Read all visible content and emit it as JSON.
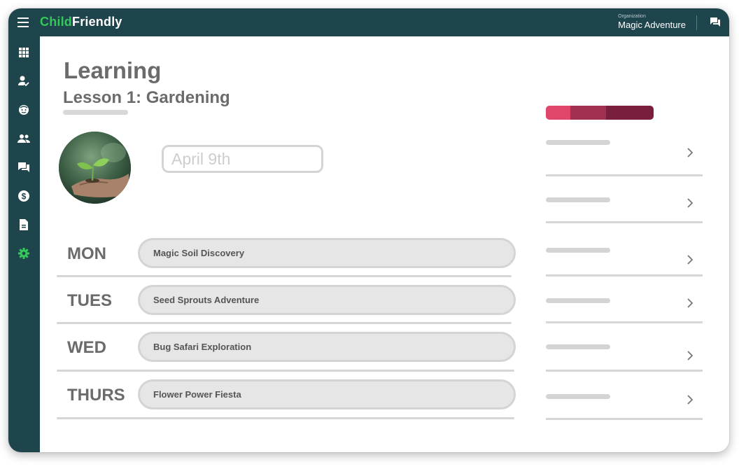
{
  "app": {
    "brand_part1": "Child",
    "brand_part2": "Friendly",
    "organization_label": "Organization",
    "organization_name": "Magic Adventure"
  },
  "sidebar": {
    "items": [
      {
        "icon": "grid-icon",
        "active": false
      },
      {
        "icon": "person-check-icon",
        "active": false
      },
      {
        "icon": "child-face-icon",
        "active": false
      },
      {
        "icon": "people-icon",
        "active": false
      },
      {
        "icon": "chat-icon",
        "active": false
      },
      {
        "icon": "dollar-icon",
        "active": false
      },
      {
        "icon": "document-icon",
        "active": false
      },
      {
        "icon": "gear-icon",
        "active": true
      }
    ]
  },
  "main": {
    "title": "Learning",
    "subtitle": "Lesson 1: Gardening",
    "date_value": "April 9th",
    "schedule": [
      {
        "day": "MON",
        "activity": "Magic Soil Discovery"
      },
      {
        "day": "TUES",
        "activity": "Seed Sprouts Adventure"
      },
      {
        "day": "WED",
        "activity": "Bug Safari Exploration"
      },
      {
        "day": "THURS",
        "activity": "Flower Power Fiesta"
      }
    ]
  },
  "progress": {
    "segments": [
      {
        "color": "#e0456a",
        "fraction": 0.23
      },
      {
        "color": "#a03050",
        "fraction": 0.33
      },
      {
        "color": "#7a1e3e",
        "fraction": 0.44
      }
    ]
  },
  "side_list": {
    "count": 6,
    "chevron": "chevron-right-icon"
  },
  "colors": {
    "nav_bg": "#1f454c",
    "brand_green": "#34c759",
    "active_icon": "#34c759",
    "text_gray": "#6b6b6b"
  }
}
